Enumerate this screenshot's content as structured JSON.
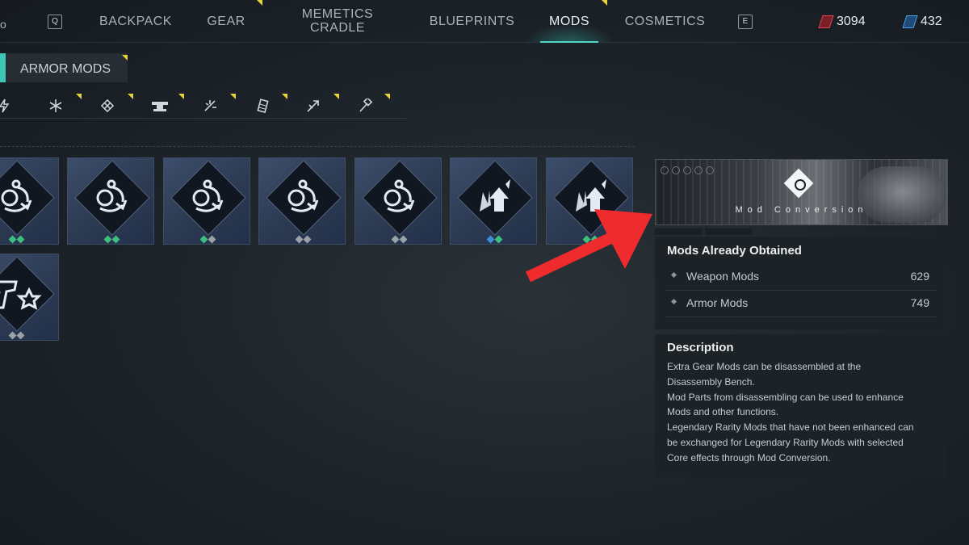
{
  "topnav": {
    "edge_char": "o",
    "left_key": "Q",
    "right_key": "E",
    "tabs": [
      {
        "label": "BACKPACK",
        "active": false
      },
      {
        "label": "GEAR",
        "active": false
      },
      {
        "label": "MEMETICS CRADLE",
        "active": false
      },
      {
        "label": "BLUEPRINTS",
        "active": false
      },
      {
        "label": "MODS",
        "active": true
      },
      {
        "label": "COSMETICS",
        "active": false
      }
    ],
    "currencies": [
      {
        "icon": "red-crystal-icon",
        "value": "3094",
        "color": "#e0464f"
      },
      {
        "icon": "blue-crystal-icon",
        "value": "432",
        "color": "#4aa3e0"
      }
    ]
  },
  "subtab": {
    "label": "ARMOR MODS"
  },
  "filters": [
    "lightning-icon",
    "snowflake-icon",
    "crosshair-icon",
    "anvil-icon",
    "burst-icon",
    "magazine-icon",
    "arrow-up-right-icon",
    "hammer-icon"
  ],
  "mods": [
    {
      "icon": "orbit-mod-icon",
      "dots": [
        "#3fbf7f",
        "#3fbf7f"
      ]
    },
    {
      "icon": "orbit-mod-icon",
      "dots": [
        "#3fbf7f",
        "#3fbf7f"
      ]
    },
    {
      "icon": "orbit-mod-icon",
      "dots": [
        "#3fbf7f",
        "#9aa2a8"
      ]
    },
    {
      "icon": "orbit-mod-icon",
      "dots": [
        "#9aa2a8",
        "#9aa2a8"
      ]
    },
    {
      "icon": "orbit-mod-icon",
      "dots": [
        "#9aa2a8",
        "#9aa2a8"
      ]
    },
    {
      "icon": "shatter-up-mod-icon",
      "dots": [
        "#3f8fd6",
        "#3fbf7f"
      ]
    },
    {
      "icon": "shatter-up-mod-icon",
      "dots": [
        "#3fbf7f",
        "#3fbf7f"
      ]
    },
    {
      "icon": "pistol-star-mod-icon",
      "dots": [
        "#9aa2a8",
        "#9aa2a8"
      ]
    }
  ],
  "panel": {
    "banner_title": "Mod Conversion",
    "obtained_title": "Mods Already Obtained",
    "stats": [
      {
        "label": "Weapon Mods",
        "value": "629"
      },
      {
        "label": "Armor Mods",
        "value": "749"
      }
    ],
    "description_title": "Description",
    "description_lines": [
      "Extra Gear Mods can be disassembled at the",
      "Disassembly Bench.",
      "Mod Parts from disassembling can be used to enhance",
      "Mods and other functions.",
      "Legendary Rarity Mods that have not been enhanced can",
      "be exchanged for Legendary Rarity Mods with selected",
      "Core effects through Mod Conversion."
    ]
  },
  "annotation": {
    "color": "#ef2b2d"
  }
}
